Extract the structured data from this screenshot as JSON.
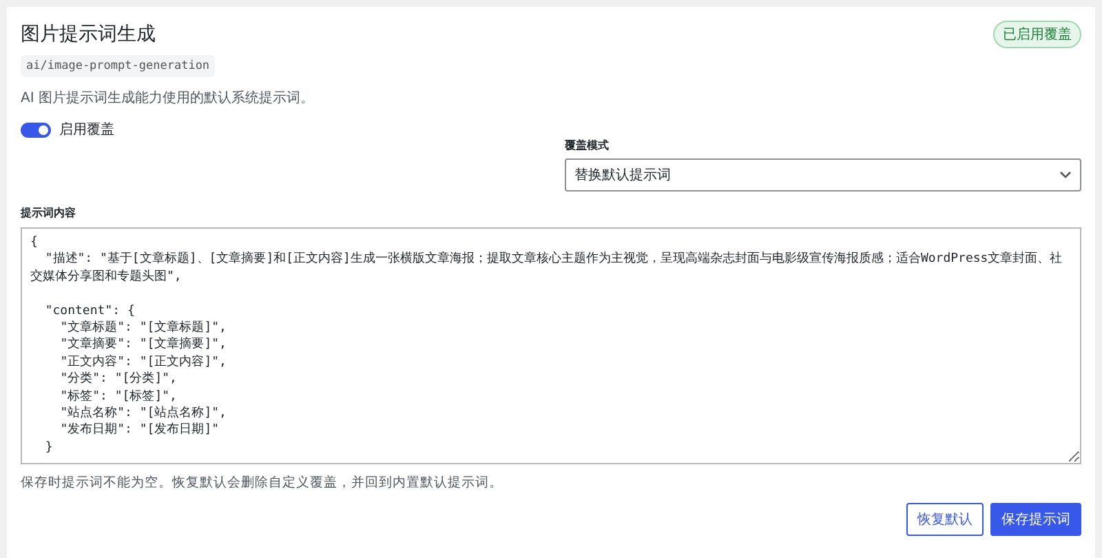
{
  "header": {
    "title": "图片提示词生成",
    "slug": "ai/image-prompt-generation",
    "status_badge": "已启用覆盖",
    "description": "AI 图片提示词生成能力使用的默认系统提示词。"
  },
  "override_toggle": {
    "label": "启用覆盖",
    "on": true
  },
  "mode_select": {
    "label": "覆盖模式",
    "value": "替换默认提示词"
  },
  "prompt_editor": {
    "label": "提示词内容",
    "value": "{\n  \"描述\": \"基于[文章标题]、[文章摘要]和[正文内容]生成一张横版文章海报；提取文章核心主题作为主视觉，呈现高端杂志封面与电影级宣传海报质感；适合WordPress文章封面、社交媒体分享图和专题头图\",\n\n  \"content\": {\n    \"文章标题\": \"[文章标题]\",\n    \"文章摘要\": \"[文章摘要]\",\n    \"正文内容\": \"[正文内容]\",\n    \"分类\": \"[分类]\",\n    \"标签\": \"[标签]\",\n    \"站点名称\": \"[站点名称]\",\n    \"发布日期\": \"[发布日期]\"\n  }"
  },
  "help_text": "保存时提示词不能为空。恢复默认会删除自定义覆盖，并回到内置默认提示词。",
  "buttons": [
    {
      "label": "恢复默认",
      "kind": "secondary"
    },
    {
      "label": "保存提示词",
      "kind": "primary"
    }
  ]
}
